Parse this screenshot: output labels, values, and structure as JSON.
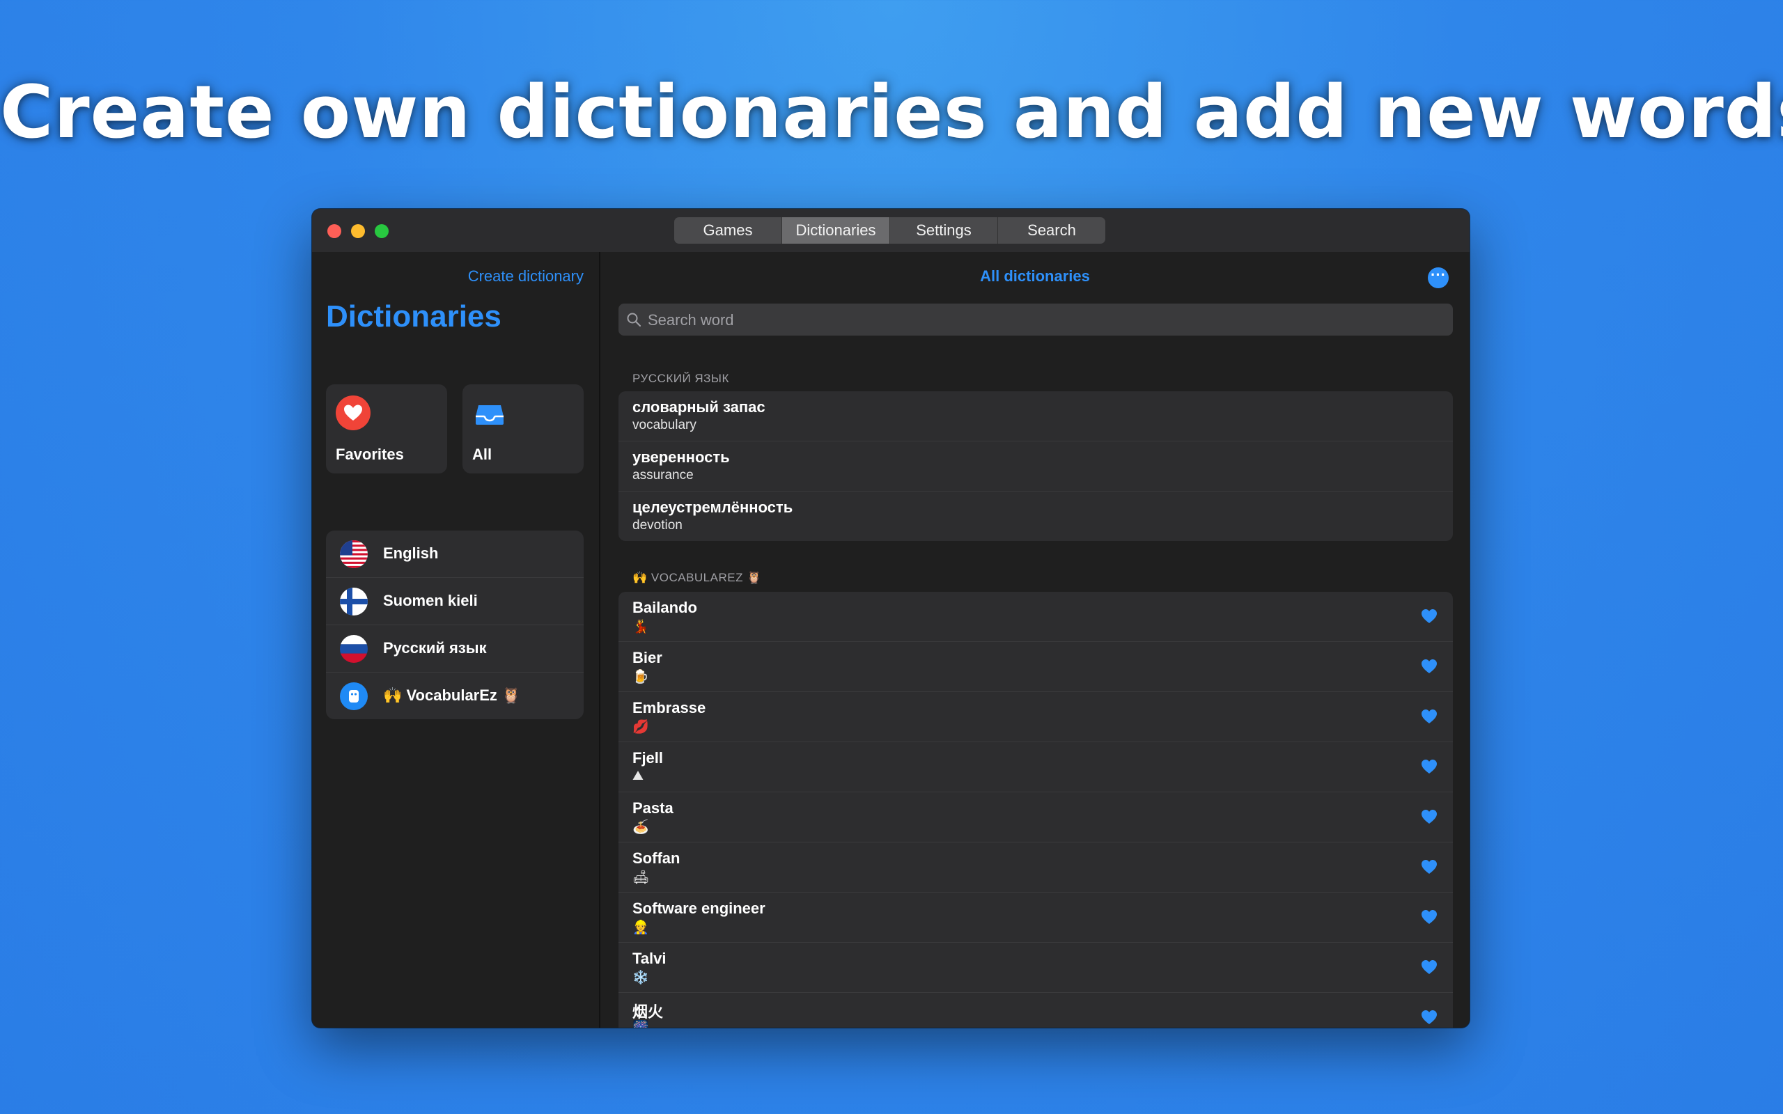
{
  "headline": "Create own dictionaries and add new words",
  "tabs": [
    {
      "label": "Games",
      "active": false
    },
    {
      "label": "Dictionaries",
      "active": true
    },
    {
      "label": "Settings",
      "active": false
    },
    {
      "label": "Search",
      "active": false
    }
  ],
  "sidebar": {
    "create_link": "Create dictionary",
    "title": "Dictionaries",
    "cards": {
      "favorites": "Favorites",
      "all": "All"
    },
    "languages": [
      {
        "label": "English",
        "icon": "us-flag-icon"
      },
      {
        "label": "Suomen kieli",
        "icon": "finland-flag-icon"
      },
      {
        "label": "Русский язык",
        "icon": "russia-flag-icon"
      },
      {
        "label": "🙌 VocabularEz 🦉",
        "icon": "vocabularez-app-icon"
      }
    ]
  },
  "main": {
    "title": "All dictionaries",
    "more_icon": "ellipsis-circle-icon",
    "search_placeholder": "Search word",
    "sections": [
      {
        "header": "РУССКИЙ ЯЗЫК",
        "rows": [
          {
            "word": "словарный запас",
            "translation": "vocabulary"
          },
          {
            "word": "уверенность",
            "translation": "assurance"
          },
          {
            "word": "целеустремлённость",
            "translation": "devotion"
          }
        ]
      },
      {
        "header": "🙌 VOCABULAREZ 🦉",
        "rows": [
          {
            "word": "Bailando",
            "translation": "💃"
          },
          {
            "word": "Bier",
            "translation": "🍺"
          },
          {
            "word": "Embrasse",
            "translation": "💋"
          },
          {
            "word": "Fjell",
            "translation": "⛰"
          },
          {
            "word": "Pasta",
            "translation": "🍝"
          },
          {
            "word": "Soffan",
            "translation": "🛋"
          },
          {
            "word": "Software engineer",
            "translation": "👷"
          },
          {
            "word": "Talvi",
            "translation": "❄️"
          },
          {
            "word": "烟火",
            "translation": "🎆"
          }
        ]
      }
    ]
  },
  "colors": {
    "accent": "#2e90fa",
    "favorite_red": "#f04438",
    "window_bg": "#1f1f1f",
    "card_bg": "#2d2d2f"
  }
}
